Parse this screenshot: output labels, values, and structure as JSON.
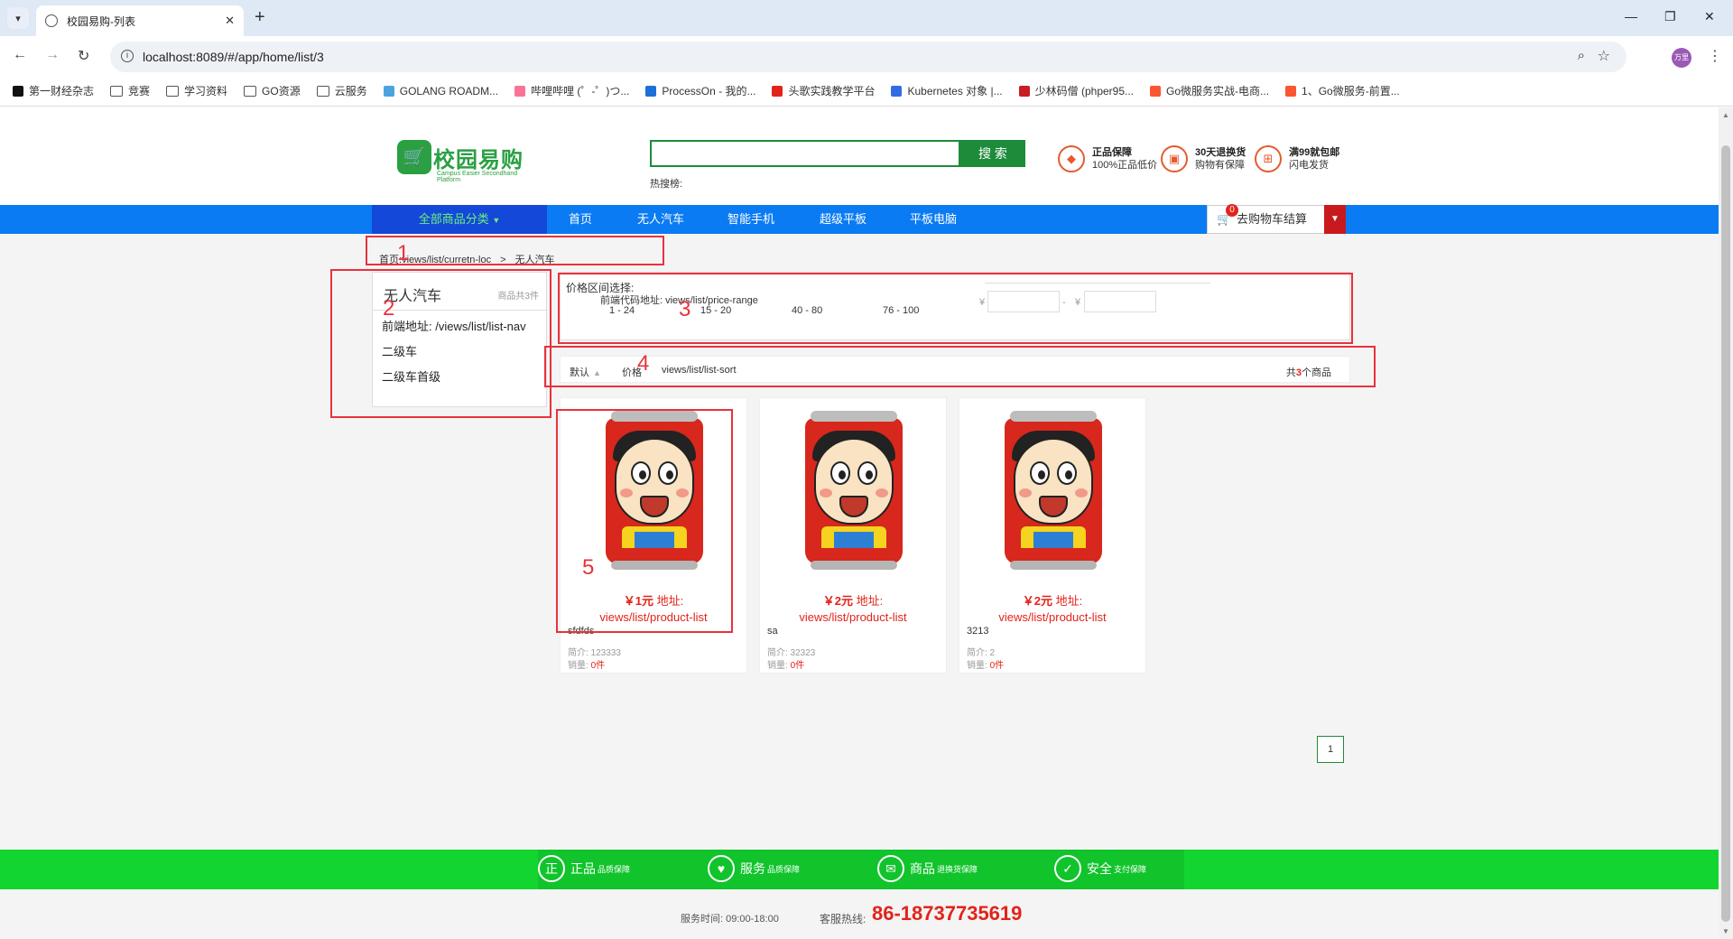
{
  "browser": {
    "tab_title": "校园易购-列表",
    "url": "localhost:8089/#/app/home/list/3",
    "profile_label": "万里",
    "bookmarks": [
      {
        "label": "第一财经杂志",
        "icon": "yi-icon"
      },
      {
        "label": "竞赛",
        "icon": "folder-icon"
      },
      {
        "label": "学习资料",
        "icon": "folder-icon"
      },
      {
        "label": "GO资源",
        "icon": "folder-icon"
      },
      {
        "label": "云服务",
        "icon": "folder-icon"
      },
      {
        "label": "GOLANG ROADM...",
        "icon": "page-icon"
      },
      {
        "label": "哔哩哔哩 (゜-゜)つ...",
        "icon": "bilibili-icon"
      },
      {
        "label": "ProcessOn - 我的...",
        "icon": "processon-icon"
      },
      {
        "label": "头歌实践教学平台",
        "icon": "toge-icon"
      },
      {
        "label": "Kubernetes 对象 |...",
        "icon": "k8s-icon"
      },
      {
        "label": "少林码僧 (phper95...",
        "icon": "gitee-icon"
      },
      {
        "label": "Go微服务实战-电商...",
        "icon": "csdn-icon"
      },
      {
        "label": "1、Go微服务-前置...",
        "icon": "csdn-icon"
      }
    ]
  },
  "header": {
    "logo_name": "校园易购",
    "logo_sub": "Campus Easier Secondhand Platform",
    "search_button": "搜 索",
    "hot_words_label": "热搜榜:",
    "guarantees": [
      {
        "title": "正品保障",
        "sub": "100%正品低价"
      },
      {
        "title": "30天退换货",
        "sub": "购物有保障"
      },
      {
        "title": "满99就包邮",
        "sub": "闪电发货"
      }
    ]
  },
  "nav": {
    "all_categories": "全部商品分类",
    "links": [
      "首页",
      "无人汽车",
      "智能手机",
      "超级平板",
      "平板电脑"
    ],
    "cart_label": "去购物车结算",
    "cart_count": "0"
  },
  "annotations": [
    "1",
    "2",
    "3",
    "4",
    "5"
  ],
  "breadcrumb": {
    "home": "首页:",
    "path": "views/list/curretn-loc",
    "sep": ">",
    "current": "无人汽车"
  },
  "category_panel": {
    "title": "无人汽车",
    "count": "商品共3件",
    "items": [
      "前端地址: /views/list/list-nav",
      "二级车",
      "二级车首级"
    ]
  },
  "price_panel": {
    "label": "价格区间选择:",
    "path_label": "前端代码地址: views/list/price-range",
    "ranges": [
      "1 - 24",
      "15 - 20",
      "40 - 80",
      "76 - 100"
    ],
    "currency": "¥",
    "dash": "-"
  },
  "sort_bar": {
    "default_label": "默认",
    "price_label": "价格",
    "path": "views/list/list-sort",
    "total_prefix": "共",
    "total_count": "3",
    "total_suffix": "个商品"
  },
  "products": [
    {
      "price": "￥1元",
      "addr_label": "地址:",
      "addr": "views/list/product-list",
      "name": "sfdfds",
      "desc": "简介: 123333",
      "sold_label": "销量:",
      "sold": "0件"
    },
    {
      "price": "￥2元",
      "addr_label": "地址:",
      "addr": "views/list/product-list",
      "name": "sa",
      "desc": "简介: 32323",
      "sold_label": "销量:",
      "sold": "0件"
    },
    {
      "price": "￥2元",
      "addr_label": "地址:",
      "addr": "views/list/product-list",
      "name": "3213",
      "desc": "简介: 2",
      "sold_label": "销量:",
      "sold": "0件"
    }
  ],
  "pagination": {
    "current": "1"
  },
  "footer": {
    "items": [
      {
        "icon": "正",
        "title": "正品",
        "sub": "品质保障"
      },
      {
        "icon": "♥",
        "title": "服务",
        "sub": "品质保障"
      },
      {
        "icon": "✉",
        "title": "商品",
        "sub": "退换货保障"
      },
      {
        "icon": "✓",
        "title": "安全",
        "sub": "支付保障"
      }
    ],
    "service_time": "服务时间: 09:00-18:00",
    "hotline_label": "客服热线:",
    "hotline": "86-18737735619"
  },
  "colors": {
    "brand_green": "#1e8b3a",
    "nav_blue": "#0a7bf3",
    "accent_red": "#e2231a",
    "footer_green": "#12d62f"
  }
}
